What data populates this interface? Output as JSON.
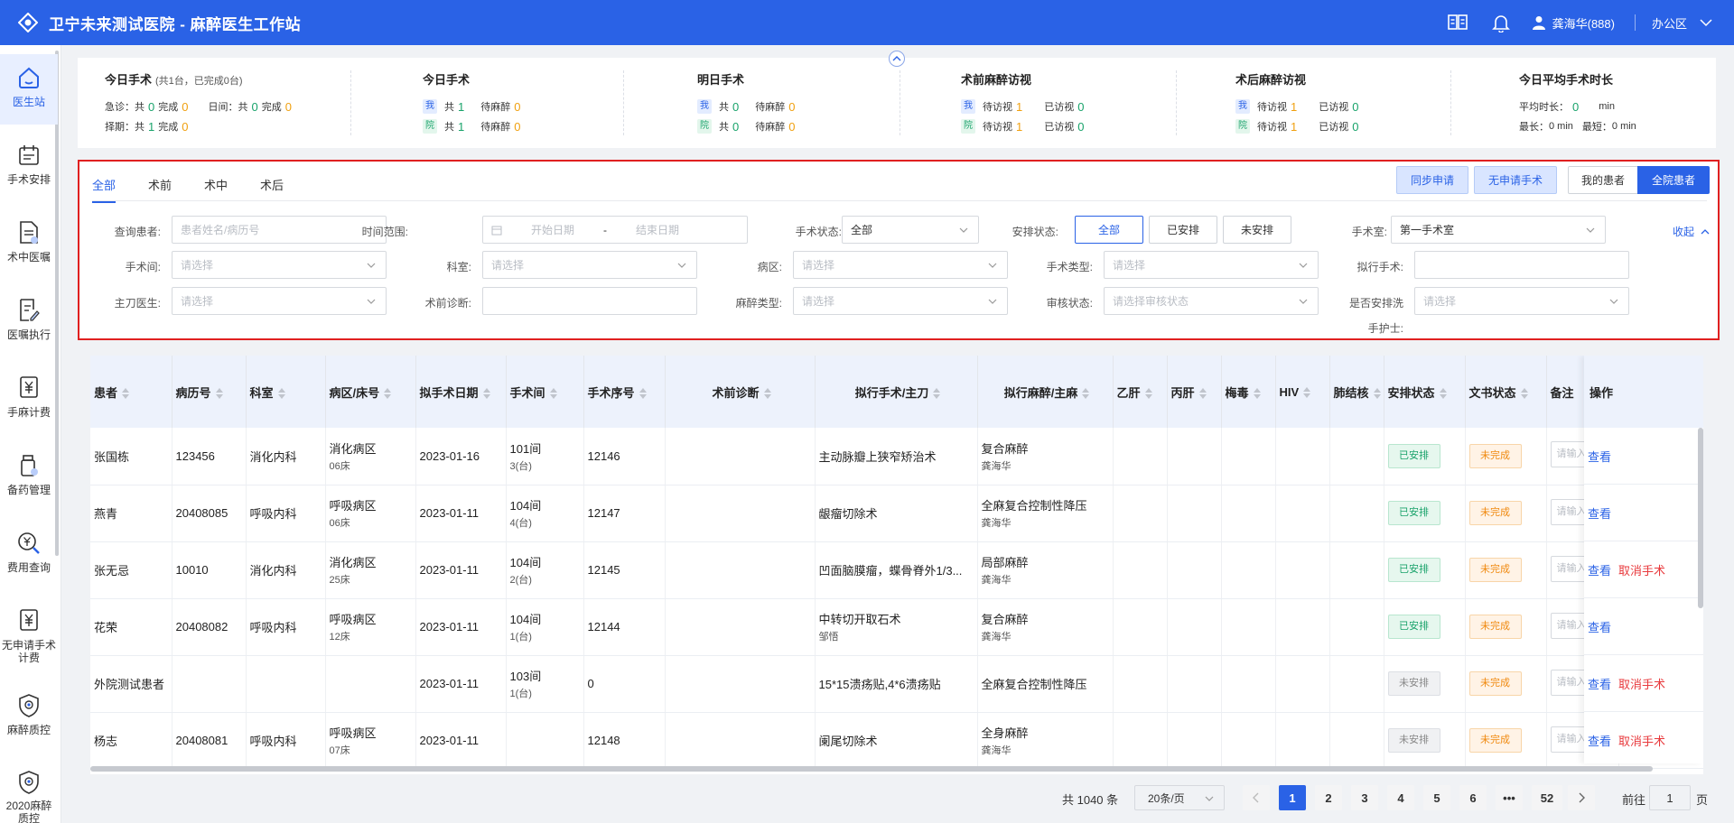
{
  "app": {
    "title": "卫宁未来测试医院 - 麻醉医生工作站"
  },
  "header": {
    "user": "龚海华(888)",
    "office": "办公区"
  },
  "sidebar": [
    {
      "label": "医生站",
      "icon": "home-icon",
      "active": true
    },
    {
      "label": "手术安排",
      "icon": "calendar-icon"
    },
    {
      "label": "术中医嘱",
      "icon": "document-icon"
    },
    {
      "label": "医嘱执行",
      "icon": "edit-document-icon"
    },
    {
      "label": "手麻计费",
      "icon": "yen-icon"
    },
    {
      "label": "备药管理",
      "icon": "medicine-icon"
    },
    {
      "label": "费用查询",
      "icon": "money-search-icon"
    },
    {
      "label": "无申请手术计费",
      "icon": "yen-document-icon"
    },
    {
      "label": "麻醉质控",
      "icon": "shield-icon"
    },
    {
      "label": "2020麻醉质控",
      "icon": "shield-icon"
    }
  ],
  "stats": {
    "today_surgery": {
      "title": "今日手术",
      "sub": "(共1台，已完成0台)",
      "emergency_label": "急诊：共",
      "emergency_total": "0",
      "emergency_done_label": "完成",
      "emergency_done": "0",
      "day_label": "日间：共",
      "day_total": "0",
      "day_done_label": "完成",
      "day_done": "0",
      "scheduled_label": "择期：共",
      "scheduled_total": "1",
      "scheduled_done_label": "完成",
      "scheduled_done": "0"
    },
    "today_surgery2": {
      "title": "今日手术",
      "me_tag": "我",
      "yuan_tag": "院",
      "total_label": "共",
      "me_total": "1",
      "yuan_total": "1",
      "wait_label": "待麻醉",
      "me_wait": "0",
      "yuan_wait": "0"
    },
    "tomorrow": {
      "title": "明日手术",
      "me_tag": "我",
      "yuan_tag": "院",
      "total_label": "共",
      "me_total": "0",
      "yuan_total": "0",
      "wait_label": "待麻醉",
      "me_wait": "0",
      "yuan_wait": "0"
    },
    "pre_visit": {
      "title": "术前麻醉访视",
      "me_tag": "我",
      "yuan_tag": "院",
      "wait_label": "待访视",
      "me_wait": "1",
      "yuan_wait": "1",
      "done_label": "已访视",
      "me_done": "0",
      "yuan_done": "0"
    },
    "post_visit": {
      "title": "术后麻醉访视",
      "me_tag": "我",
      "yuan_tag": "院",
      "wait_label": "待访视",
      "me_wait": "1",
      "yuan_wait": "1",
      "done_label": "已访视",
      "me_done": "0",
      "yuan_done": "0"
    },
    "avg": {
      "title": "今日平均手术时长",
      "avg_label": "平均时长：",
      "avg_value": "0",
      "avg_unit": "min",
      "max_label": "最长：",
      "max_value": "0 min",
      "min_label": "最短：",
      "min_value": "0 min"
    }
  },
  "filter": {
    "tabs": [
      "全部",
      "术前",
      "术中",
      "术后"
    ],
    "sync_btn": "同步申请",
    "no_apply_btn": "无申请手术",
    "my_patients": "我的患者",
    "all_patients": "全院患者",
    "collapse": "收起",
    "labels": {
      "patient": "查询患者:",
      "time_range": "时间范围:",
      "surgery_status": "手术状态:",
      "arrange_status": "安排状态:",
      "or_room": "手术室:",
      "surgery_room": "手术间:",
      "dept": "科室:",
      "ward": "病区:",
      "surgery_type": "手术类型:",
      "planned_surgery": "拟行手术:",
      "surgeon": "主刀医生:",
      "pre_diagnosis": "术前诊断:",
      "anesthesia_type": "麻醉类型:",
      "audit_status": "审核状态:",
      "arrange_nurse": "是否安排洗",
      "nurse2": "手护士:"
    },
    "placeholders": {
      "patient": "患者姓名/病历号",
      "start_date": "开始日期",
      "end_date": "结束日期",
      "select": "请选择",
      "audit": "请选择审核状态"
    },
    "date_sep": "-",
    "values": {
      "surgery_status": "全部",
      "or_room": "第一手术室"
    },
    "arrange_options": [
      "全部",
      "已安排",
      "未安排"
    ]
  },
  "table": {
    "columns": [
      "患者",
      "病历号",
      "科室",
      "病区/床号",
      "拟手术日期",
      "手术间",
      "手术序号",
      "术前诊断",
      "拟行手术/主刀",
      "拟行麻醉/主麻",
      "乙肝",
      "丙肝",
      "梅毒",
      "HIV",
      "肺结核",
      "安排状态",
      "文书状态",
      "备注"
    ],
    "op_header": "操作",
    "note_placeholder": "请输入",
    "view_label": "查看",
    "cancel_label": "取消手术",
    "rows": [
      {
        "name": "张国栋",
        "mrn": "123456",
        "dept": "消化内科",
        "ward": "消化病区",
        "bed": "06床",
        "date": "2023-01-16",
        "room": "101间",
        "room_sub": "3(台)",
        "seq": "12146",
        "diag": "",
        "surgery": "主动脉瓣上狭窄矫治术",
        "surgeon": "",
        "anes": "复合麻醉",
        "anes_doc": "龚海华",
        "arrange": "已安排",
        "arrange_kind": "green",
        "doc": "未完成",
        "cancel": false
      },
      {
        "name": "燕青",
        "mrn": "20408085",
        "dept": "呼吸内科",
        "ward": "呼吸病区",
        "bed": "06床",
        "date": "2023-01-11",
        "room": "104间",
        "room_sub": "4(台)",
        "seq": "12147",
        "diag": "",
        "surgery": "龈瘤切除术",
        "surgeon": "",
        "anes": "全麻复合控制性降压",
        "anes_doc": "龚海华",
        "arrange": "已安排",
        "arrange_kind": "green",
        "doc": "未完成",
        "cancel": false
      },
      {
        "name": "张无忌",
        "mrn": "10010",
        "dept": "消化内科",
        "ward": "消化病区",
        "bed": "25床",
        "date": "2023-01-11",
        "room": "104间",
        "room_sub": "2(台)",
        "seq": "12145",
        "diag": "",
        "surgery": "凹面脑膜瘤，蝶骨脊外1/3...",
        "surgeon": "",
        "anes": "局部麻醉",
        "anes_doc": "龚海华",
        "arrange": "已安排",
        "arrange_kind": "green",
        "doc": "未完成",
        "cancel": true
      },
      {
        "name": "花荣",
        "mrn": "20408082",
        "dept": "呼吸内科",
        "ward": "呼吸病区",
        "bed": "12床",
        "date": "2023-01-11",
        "room": "104间",
        "room_sub": "1(台)",
        "seq": "12144",
        "diag": "",
        "surgery": "中转切开取石术",
        "surgeon": "邹悟",
        "anes": "复合麻醉",
        "anes_doc": "龚海华",
        "arrange": "已安排",
        "arrange_kind": "green",
        "doc": "未完成",
        "cancel": false
      },
      {
        "name": "外院测试患者",
        "mrn": "",
        "dept": "",
        "ward": "",
        "bed": "",
        "date": "2023-01-11",
        "room": "103间",
        "room_sub": "1(台)",
        "seq": "0",
        "diag": "",
        "surgery": "15*15溃疡贴,4*6溃疡贴",
        "surgeon": "",
        "anes": "全麻复合控制性降压",
        "anes_doc": "",
        "arrange": "未安排",
        "arrange_kind": "gray",
        "doc": "未完成",
        "cancel": true
      },
      {
        "name": "杨志",
        "mrn": "20408081",
        "dept": "呼吸内科",
        "ward": "呼吸病区",
        "bed": "07床",
        "date": "2023-01-11",
        "room": "",
        "room_sub": "",
        "seq": "12148",
        "diag": "",
        "surgery": "阑尾切除术",
        "surgeon": "",
        "anes": "全身麻醉",
        "anes_doc": "龚海华",
        "arrange": "未安排",
        "arrange_kind": "gray",
        "doc": "未完成",
        "cancel": true
      }
    ]
  },
  "pagination": {
    "total": "共 1040 条",
    "page_size": "20条/页",
    "pages": [
      "1",
      "2",
      "3",
      "4",
      "5",
      "6",
      "•••",
      "52"
    ],
    "current": "1",
    "goto_label": "前往",
    "goto_value": "1",
    "goto_unit": "页"
  }
}
